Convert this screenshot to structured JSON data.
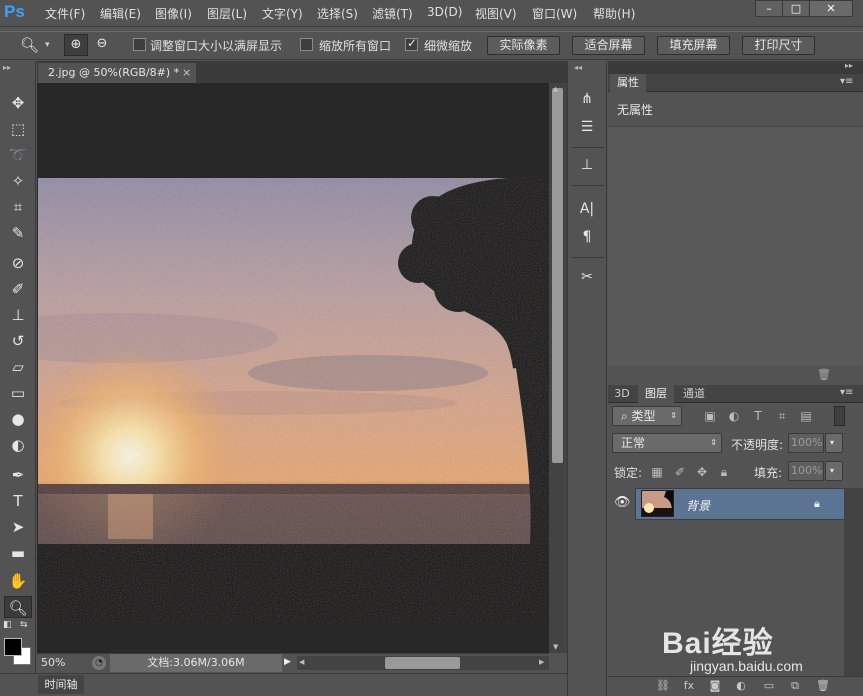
{
  "app": {
    "logo": "Ps"
  },
  "menu": [
    "文件(F)",
    "编辑(E)",
    "图像(I)",
    "图层(L)",
    "文字(Y)",
    "选择(S)",
    "滤镜(T)",
    "3D(D)",
    "视图(V)",
    "窗口(W)",
    "帮助(H)"
  ],
  "window_controls": {
    "minimize": "–",
    "maximize": "□",
    "close": "✕"
  },
  "options": {
    "resize_windows": {
      "label": "调整窗口大小以满屏显示",
      "checked": false
    },
    "zoom_all": {
      "label": "缩放所有窗口",
      "checked": false
    },
    "scrubby_zoom": {
      "label": "细微缩放",
      "checked": true
    },
    "buttons": [
      "实际像素",
      "适合屏幕",
      "填充屏幕",
      "打印尺寸"
    ]
  },
  "document": {
    "tab_title": "2.jpg @ 50%(RGB/8#) *",
    "tab_close": "×",
    "zoom": "50%",
    "info": "文档:3.06M/3.06M"
  },
  "timeline": {
    "label": "时间轴"
  },
  "properties": {
    "tab": "属性",
    "empty_text": "无属性"
  },
  "layers": {
    "tabs": [
      "3D",
      "图层",
      "通道"
    ],
    "active_tab": "图层",
    "filter_kind": "类型",
    "blend_mode": "正常",
    "opacity_label": "不透明度:",
    "opacity_value": "100%",
    "lock_label": "锁定:",
    "fill_label": "填充:",
    "fill_value": "100%",
    "items": [
      {
        "name": "背景",
        "visible": true,
        "locked": true
      }
    ]
  },
  "watermark": {
    "text": "Bai经验",
    "url": "jingyan.baidu.com"
  },
  "colors": {
    "accent": "#3fa1f3",
    "selection": "#5b7494"
  }
}
